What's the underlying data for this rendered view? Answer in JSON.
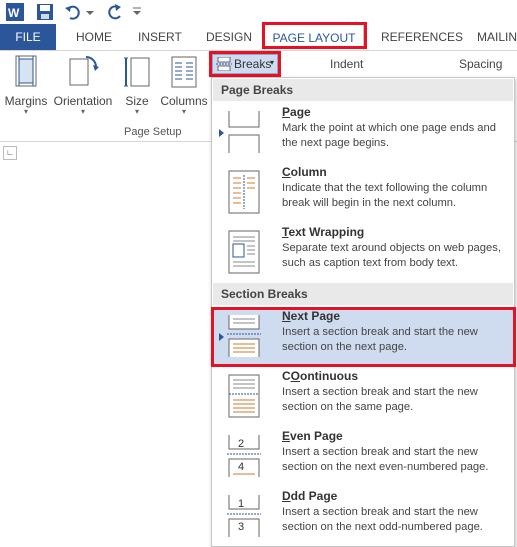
{
  "tabs": {
    "file": "FILE",
    "home": "HOME",
    "insert": "INSERT",
    "design": "DESIGN",
    "page_layout": "PAGE LAYOUT",
    "references": "REFERENCES",
    "mailings": "MAILIN"
  },
  "ribbon": {
    "margins": "Margins",
    "orientation": "Orientation",
    "size": "Size",
    "columns": "Columns",
    "breaks": "Breaks",
    "indent": "Indent",
    "spacing": "Spacing",
    "page_setup": "Page Setup"
  },
  "menu": {
    "page_breaks_header": "Page Breaks",
    "section_breaks_header": "Section Breaks",
    "items": [
      {
        "title_u": "P",
        "title_rest": "age",
        "desc": "Mark the point at which one page ends and the next page begins."
      },
      {
        "title_u": "C",
        "title_rest": "olumn",
        "desc": "Indicate that the text following the column break will begin in the next column."
      },
      {
        "title_u": "T",
        "title_rest": "ext Wrapping",
        "desc": "Separate text around objects on web pages, such as caption text from body text."
      },
      {
        "title_u": "N",
        "title_rest": "ext Page",
        "desc": "Insert a section break and start the new section on the next page."
      },
      {
        "title_u": "O",
        "title_rest": "ontinuous",
        "desc": "Insert a section break and start the new section on the same page."
      },
      {
        "title_u": "E",
        "title_rest": "ven Page",
        "desc": "Insert a section break and start the new section on the next even-numbered page."
      },
      {
        "title_u": "D",
        "title_rest": "dd Page",
        "desc": "Insert a section break and start the new section on the next odd-numbered page."
      }
    ]
  },
  "icon_numbers": {
    "even_top": "2",
    "even_bottom": "4",
    "odd_top": "1",
    "odd_bottom": "3"
  },
  "colors": {
    "accent": "#2b579a",
    "highlight": "#e81123",
    "hover": "#cfdcef"
  }
}
